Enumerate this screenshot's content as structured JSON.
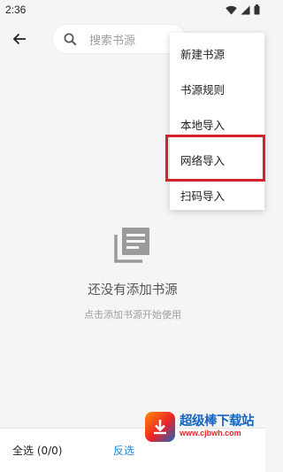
{
  "status_bar": {
    "time": "2:36",
    "icons": [
      "wifi-icon",
      "signal-icon",
      "battery-icon"
    ]
  },
  "toolbar": {
    "back_icon": "arrow-back-icon",
    "search_placeholder": "搜索书源"
  },
  "menu": {
    "items": [
      {
        "label": "新建书源"
      },
      {
        "label": "书源规则"
      },
      {
        "label": "本地导入"
      },
      {
        "label": "网络导入",
        "highlighted": true
      },
      {
        "label": "扫码导入"
      }
    ],
    "highlight_color": "#d2232a"
  },
  "empty_state": {
    "icon": "book-library-icon",
    "title": "还没有添加书源",
    "subtitle": "点击添加书源开始使用"
  },
  "bottom_bar": {
    "select_all": "全选 (0/0)",
    "invert": "反选",
    "accent": "#1e88e5"
  },
  "watermark": {
    "text": "超级棒下载站",
    "url": "www.cjbwh.com"
  }
}
